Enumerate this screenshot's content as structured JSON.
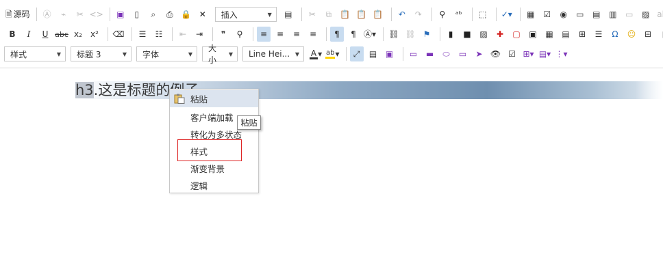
{
  "toolbar": {
    "row1": {
      "source_label": "源码",
      "insert_select": "插入"
    },
    "row2": {
      "bold": "B",
      "italic": "I",
      "underline": "U",
      "strike": "abc",
      "subscript": "x₂",
      "superscript": "x²",
      "special_char": "Ω"
    },
    "row3": {
      "style_select": "样式",
      "format_select": "标题 3",
      "font_select": "字体",
      "size_select": "大小",
      "lineheight_select": "Line Hei..."
    }
  },
  "editor": {
    "heading_prefix": "h3",
    "heading_text": ".这是标题的例子"
  },
  "context_menu": {
    "items": [
      {
        "label": "粘贴"
      },
      {
        "label": "客户端加载"
      },
      {
        "label": "转化为多状态"
      },
      {
        "label": "样式"
      },
      {
        "label": "渐变背景"
      },
      {
        "label": "逻辑"
      }
    ],
    "tooltip": "粘贴"
  },
  "colors": {
    "highlight_box": "#dd2222",
    "hover_bg": "#dce4ef",
    "active_btn": "#c8dcf0"
  }
}
